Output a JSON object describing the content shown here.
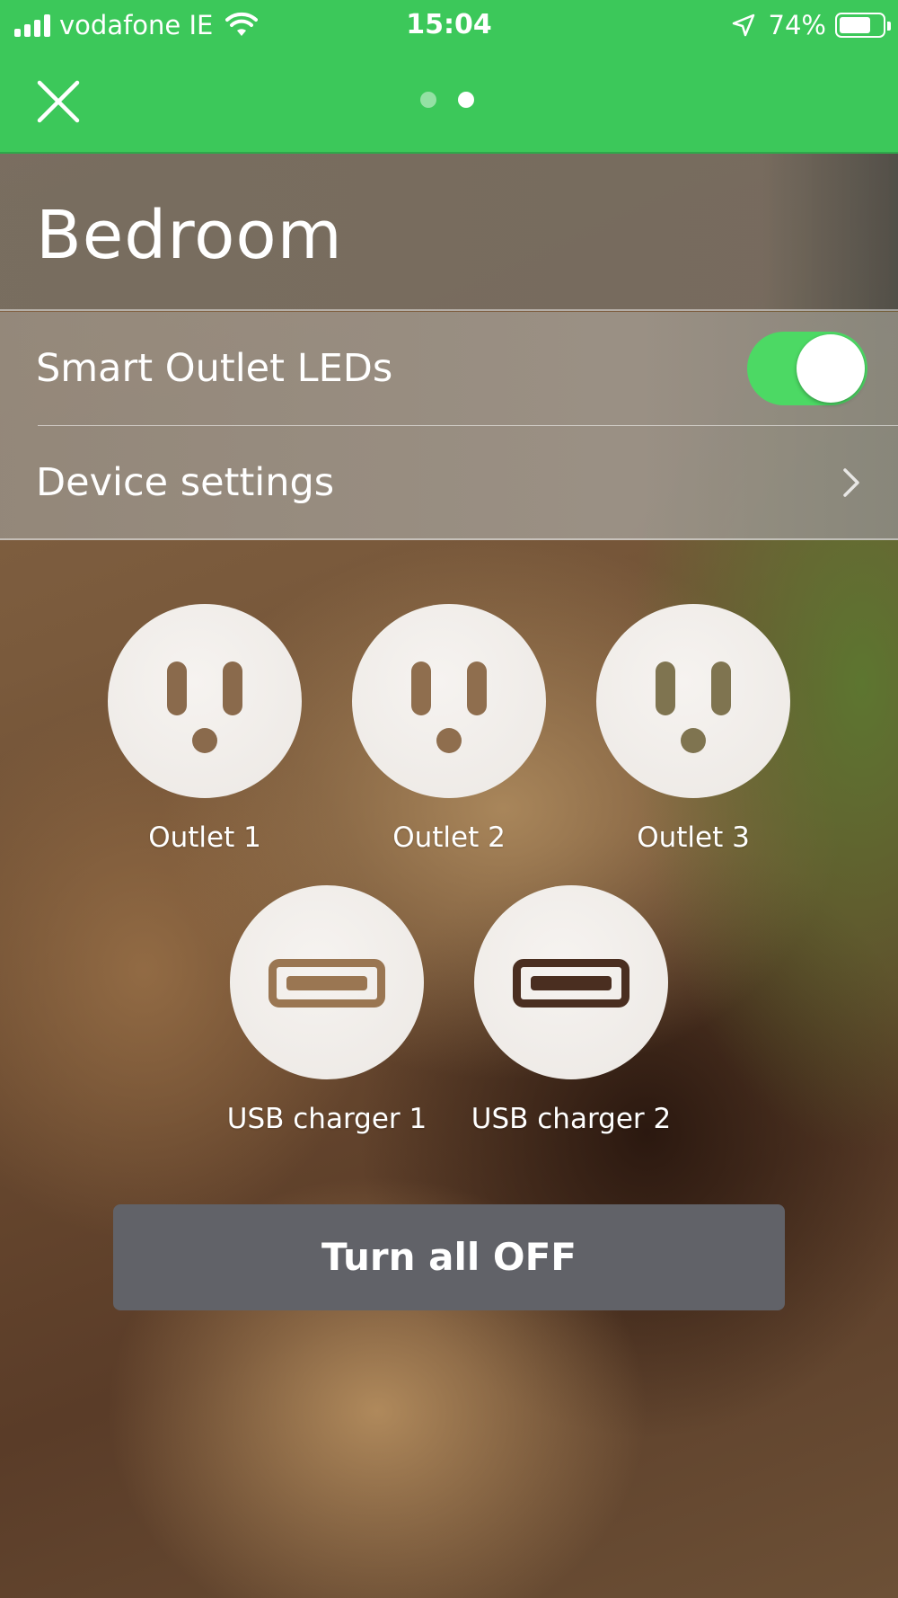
{
  "status_bar": {
    "carrier": "vodafone IE",
    "time": "15:04",
    "battery": "74%",
    "battery_level": 0.74
  },
  "nav": {
    "page_count": 2,
    "active_page": 2
  },
  "room": {
    "title": "Bedroom"
  },
  "settings": {
    "leds_label": "Smart Outlet LEDs",
    "leds_on": true,
    "device_settings_label": "Device settings"
  },
  "outlets": [
    {
      "label": "Outlet 1",
      "color": "#8a6a4c"
    },
    {
      "label": "Outlet 2",
      "color": "#8f6e4e"
    },
    {
      "label": "Outlet 3",
      "color": "#7f7450"
    }
  ],
  "usb_chargers": [
    {
      "label": "USB charger 1",
      "color": "#9a7652"
    },
    {
      "label": "USB charger 2",
      "color": "#4a2e20"
    }
  ],
  "actions": {
    "turn_all_off": "Turn all OFF"
  },
  "colors": {
    "accent": "#3cc85a",
    "toggle_on": "#4cd964",
    "button": "#616268"
  }
}
